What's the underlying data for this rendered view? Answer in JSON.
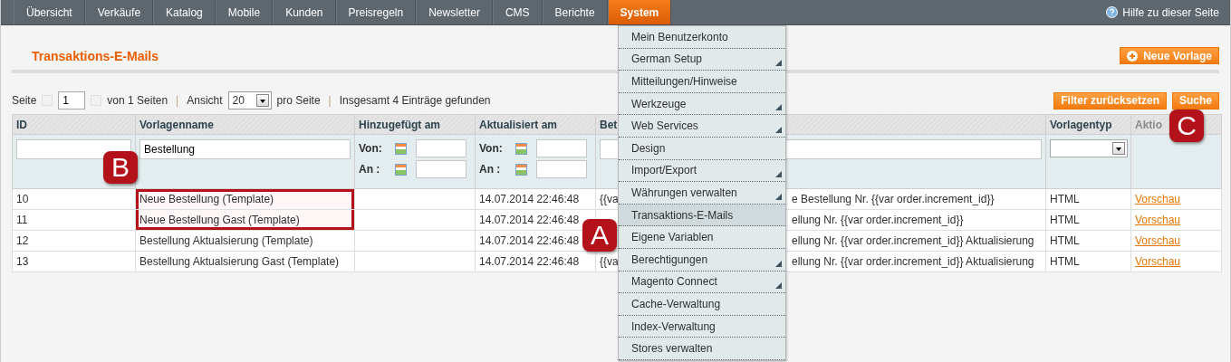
{
  "nav": {
    "items": [
      {
        "label": "Übersicht",
        "selected": false
      },
      {
        "label": "Verkäufe",
        "selected": false
      },
      {
        "label": "Katalog",
        "selected": false
      },
      {
        "label": "Mobile",
        "selected": false
      },
      {
        "label": "Kunden",
        "selected": false
      },
      {
        "label": "Preisregeln",
        "selected": false
      },
      {
        "label": "Newsletter",
        "selected": false
      },
      {
        "label": "CMS",
        "selected": false
      },
      {
        "label": "Berichte",
        "selected": false
      },
      {
        "label": "System",
        "selected": true
      }
    ],
    "help": "Hilfe zu dieser Seite"
  },
  "page_title": "Transaktions-E-Mails",
  "new_button": "Neue Vorlage",
  "pager": {
    "page_label": "Seite",
    "page": "1",
    "of_pages": "von 1 Seiten",
    "separator_1": "|",
    "view_label": "Ansicht",
    "per_page": "20",
    "per_page_label": "pro Seite",
    "separator_2": "|",
    "total": "Insgesamt 4 Einträge gefunden"
  },
  "reset_button": "Filter zurücksetzen",
  "search_button": "Suche",
  "table": {
    "columns": [
      {
        "label": "ID",
        "sortable": true
      },
      {
        "label": "Vorlagenname",
        "sortable": true
      },
      {
        "label": "Hinzugefügt am",
        "sortable": true
      },
      {
        "label": "Aktualisiert am",
        "sortable": true
      },
      {
        "label": "Bet",
        "sortable": true
      },
      {
        "label": "Vorlagentyp",
        "sortable": true
      },
      {
        "label": "Aktio",
        "sortable": false
      }
    ],
    "filters": {
      "name": "Bestellung",
      "dates": [
        {
          "from_label": "Von:",
          "to_label": "An :"
        },
        {
          "from_label": "Von:",
          "to_label": "An :"
        }
      ]
    },
    "rows": [
      {
        "id": "10",
        "name": "Neue Bestellung (Template)",
        "highlighted": true,
        "updated": "14.07.2014 22:46:48",
        "subject_left": "{{va",
        "subject_right": "e Bestellung Nr. {{var order.increment_id}}",
        "type": "HTML",
        "action": "Vorschau"
      },
      {
        "id": "11",
        "name": "Neue Bestellung Gast (Template)",
        "highlighted": true,
        "updated": "14.07.2014 22:46:48",
        "subject_right": "ellung Nr. {{var order.increment_id}}",
        "type": "HTML",
        "action": "Vorschau"
      },
      {
        "id": "12",
        "name": "Bestellung Aktualsierung (Template)",
        "highlighted": false,
        "updated": "14.07.2014 22:46:48",
        "subject_right": "ellung Nr. {{var order.increment_id}} Aktualisierung",
        "type": "HTML",
        "action": "Vorschau"
      },
      {
        "id": "13",
        "name": "Bestellung Aktualsierung Gast (Template)",
        "highlighted": false,
        "updated": "14.07.2014 22:46:48",
        "subject_left": "{{va",
        "subject_right": "ellung Nr. {{var order.increment_id}} Aktualisierung",
        "type": "HTML",
        "action": "Vorschau"
      }
    ]
  },
  "menu": {
    "items": [
      {
        "label": "Mein Benutzerkonto",
        "submenu": false,
        "selected": false
      },
      {
        "label": "German Setup",
        "submenu": true,
        "selected": false
      },
      {
        "label": "Mitteilungen/Hinweise",
        "submenu": false,
        "selected": false
      },
      {
        "label": "Werkzeuge",
        "submenu": true,
        "selected": false
      },
      {
        "label": "Web Services",
        "submenu": true,
        "selected": false
      },
      {
        "label": "Design",
        "submenu": false,
        "selected": false
      },
      {
        "label": "Import/Export",
        "submenu": true,
        "selected": false
      },
      {
        "label": "Währungen verwalten",
        "submenu": true,
        "selected": false
      },
      {
        "label": "Transaktions-E-Mails",
        "submenu": false,
        "selected": true
      },
      {
        "label": "Eigene Variablen",
        "submenu": false,
        "selected": false
      },
      {
        "label": "Berechtigungen",
        "submenu": true,
        "selected": false
      },
      {
        "label": "Magento Connect",
        "submenu": true,
        "selected": false
      },
      {
        "label": "Cache-Verwaltung",
        "submenu": false,
        "selected": false
      },
      {
        "label": "Index-Verwaltung",
        "submenu": false,
        "selected": false
      },
      {
        "label": "Stores verwalten",
        "submenu": false,
        "selected": false
      }
    ]
  },
  "annotations": [
    {
      "label": "A"
    },
    {
      "label": "B"
    },
    {
      "label": "C"
    }
  ]
}
